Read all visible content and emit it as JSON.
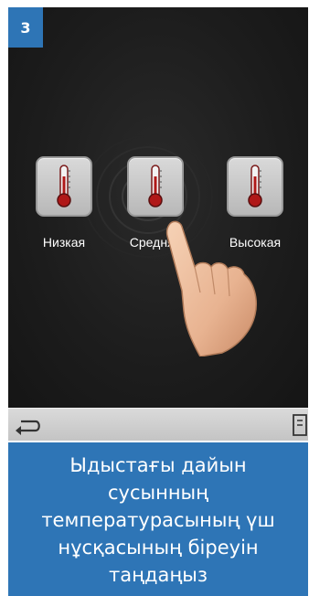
{
  "step": {
    "number": "3"
  },
  "options": [
    {
      "label": "Низкая",
      "icon": "thermometer-icon"
    },
    {
      "label": "Средняя",
      "icon": "thermometer-icon"
    },
    {
      "label": "Высокая",
      "icon": "thermometer-icon"
    }
  ],
  "toolbar": {
    "back_icon": "back-arrow-icon",
    "dispense_icon": "cup-icon"
  },
  "caption": {
    "text": "Ыдыстағы дайын сусынның температурасының үш нұсқасының біреуін таңдаңыз"
  },
  "colors": {
    "accent": "#2e75b6",
    "screen_bg": "#1e1e1e",
    "tile": "#c8c8c8"
  }
}
